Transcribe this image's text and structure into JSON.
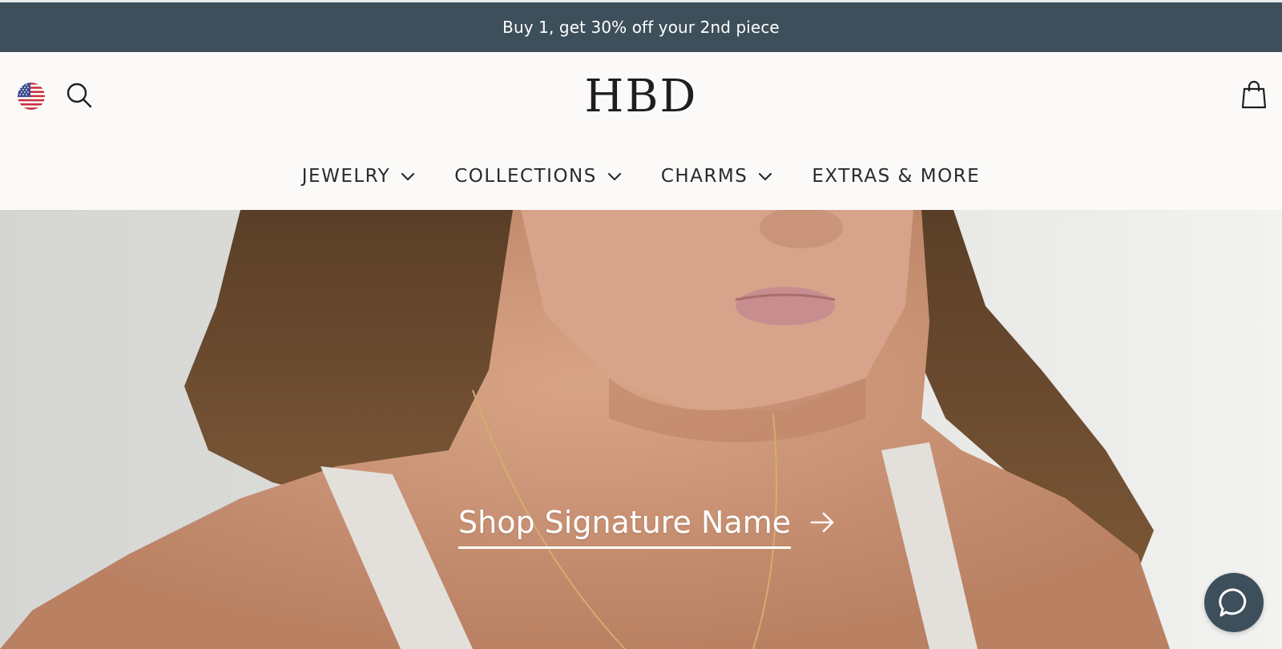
{
  "announcement": {
    "text": "Buy 1, get 30% off your 2nd piece"
  },
  "header": {
    "logo_text": "HBD",
    "locale_icon": "us-flag-icon",
    "search_icon": "search-icon",
    "cart_icon": "shopping-bag-icon"
  },
  "nav": {
    "items": [
      {
        "label": "JEWELRY",
        "has_dropdown": true
      },
      {
        "label": "COLLECTIONS",
        "has_dropdown": true
      },
      {
        "label": "CHARMS",
        "has_dropdown": true
      },
      {
        "label": "EXTRAS & MORE",
        "has_dropdown": false
      }
    ]
  },
  "hero": {
    "cta_label": "Shop Signature Name",
    "cta_icon": "arrow-right-icon"
  },
  "chat": {
    "icon": "chat-bubble-icon"
  },
  "colors": {
    "announcement_bg": "#3d4f5b",
    "header_bg": "#fbfaf8",
    "text_dark": "#2a2a2a",
    "chat_bg": "#3d4f5b"
  }
}
